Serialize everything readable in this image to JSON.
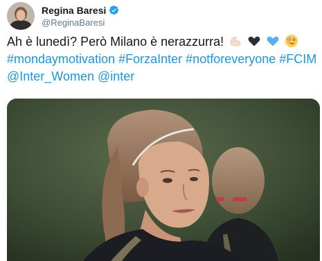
{
  "author": {
    "display_name": "Regina Baresi",
    "handle": "@ReginaBaresi",
    "verified": true,
    "avatar_icon": "avatar-photo"
  },
  "tweet": {
    "text_intro": "Ah è lunedì? Però Milano è nerazzurra!",
    "emojis": [
      "flexed-biceps-light-skin",
      "black-heart",
      "blue-heart",
      "zany-face"
    ],
    "hashtag_1": "#mondaymotivation",
    "hashtag_2": "#ForzaInter",
    "hashtag_3": "#notforeveryone",
    "hashtag_4": "#FCIM",
    "mention_1": "@Inter_Women",
    "mention_2": "@inter"
  },
  "media": {
    "type": "photo"
  },
  "colors": {
    "link": "#1b95e0",
    "verified": "#1da1f2",
    "text": "#14171a",
    "muted": "#657786"
  }
}
